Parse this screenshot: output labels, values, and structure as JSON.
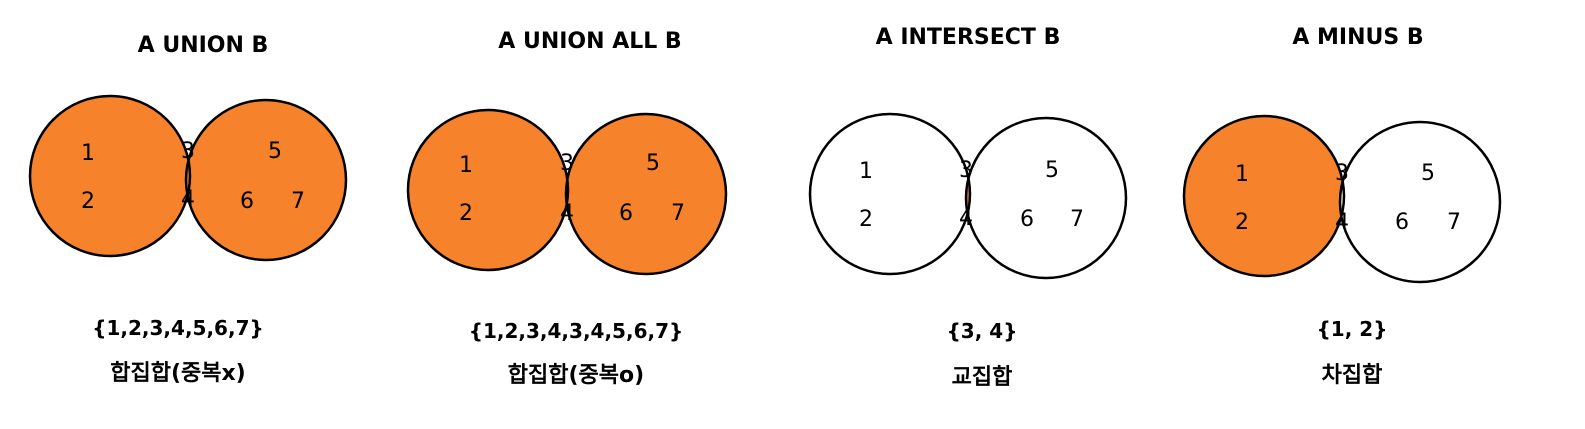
{
  "colors": {
    "fill": "#f7822c",
    "stroke": "#000000",
    "background": "#ffffff"
  },
  "panels": [
    {
      "title": "A UNION B",
      "shaded": "union",
      "numbers": [
        "1",
        "2",
        "3",
        "4",
        "5",
        "6",
        "7"
      ],
      "result": "{1,2,3,4,5,6,7}",
      "caption": "합집합(중복x)"
    },
    {
      "title": "A UNION ALL B",
      "shaded": "union",
      "numbers": [
        "1",
        "2",
        "3",
        "4",
        "5",
        "6",
        "7"
      ],
      "result": "{1,2,3,4,3,4,5,6,7}",
      "caption": "합집합(중복o)"
    },
    {
      "title": "A INTERSECT B",
      "shaded": "intersection",
      "numbers": [
        "1",
        "2",
        "3",
        "4",
        "5",
        "6",
        "7"
      ],
      "result": "{3, 4}",
      "caption": "교집합"
    },
    {
      "title": "A MINUS B",
      "shaded": "a-minus-b",
      "numbers": [
        "1",
        "2",
        "3",
        "4",
        "5",
        "6",
        "7"
      ],
      "result": "{1, 2}",
      "caption": "차집합"
    }
  ]
}
